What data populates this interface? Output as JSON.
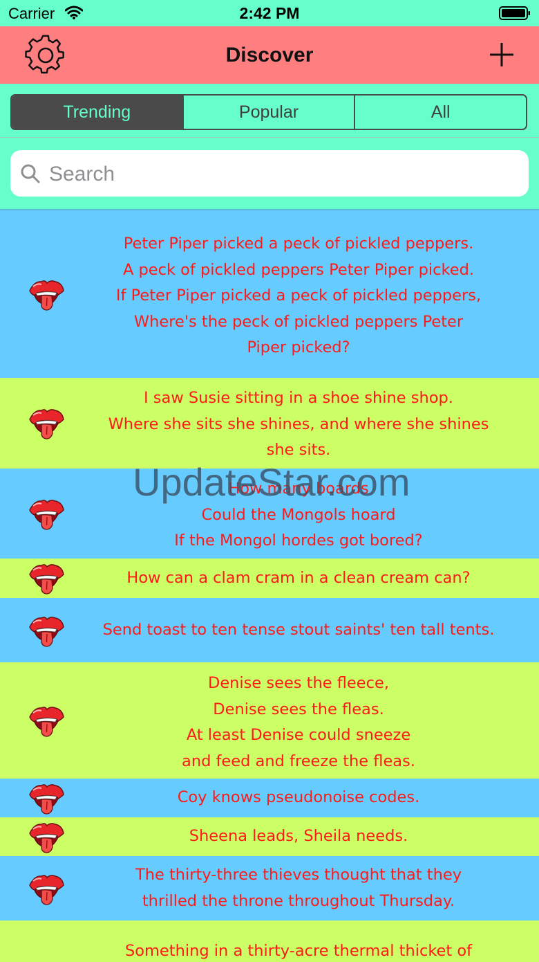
{
  "status_bar": {
    "carrier": "Carrier",
    "time": "2:42 PM"
  },
  "nav": {
    "title": "Discover"
  },
  "segments": [
    {
      "label": "Trending",
      "selected": true
    },
    {
      "label": "Popular",
      "selected": false
    },
    {
      "label": "All",
      "selected": false
    }
  ],
  "search": {
    "placeholder": "Search",
    "value": ""
  },
  "watermark": "UpdateStar.com",
  "tongue_twisters": [
    {
      "text": "Peter Piper picked a peck of pickled peppers.\nA peck of pickled peppers Peter Piper picked.\nIf Peter Piper picked a peck of pickled peppers,\nWhere's the peck of pickled peppers Peter\nPiper picked?",
      "color": "#66ccff"
    },
    {
      "text": "I saw Susie sitting in a shoe shine shop.\nWhere she sits she shines, and where she shines\nshe sits.",
      "color": "#ccff66"
    },
    {
      "text": "How many boards\nCould the Mongols hoard\nIf the Mongol hordes got bored?",
      "color": "#66ccff"
    },
    {
      "text": "How can a clam cram in a clean cream can?",
      "color": "#ccff66"
    },
    {
      "text": "Send toast to ten tense stout saints' ten tall tents.",
      "color": "#66ccff"
    },
    {
      "text": "Denise sees the fleece,\nDenise sees the fleas.\nAt least Denise could sneeze\nand feed and freeze the fleas.",
      "color": "#ccff66"
    },
    {
      "text": "Coy knows pseudonoise codes.",
      "color": "#66ccff"
    },
    {
      "text": "Sheena leads, Sheila needs.",
      "color": "#ccff66"
    },
    {
      "text": "The thirty-three thieves thought that they\nthrilled the throne throughout Thursday.",
      "color": "#66ccff"
    },
    {
      "text": "Something in a thirty-acre thermal thicket of",
      "color": "#ccff66"
    }
  ],
  "icons": {
    "settings": "gear-icon",
    "add": "plus-icon",
    "row": "lips-tongue-icon",
    "search": "magnifier-icon"
  },
  "colors": {
    "background": "#66ffcc",
    "nav_bar": "#ff7f80",
    "row_blue": "#66ccff",
    "row_green": "#ccff66",
    "row_text": "#ff1a1a",
    "segment_active": "#4a4a4a"
  }
}
